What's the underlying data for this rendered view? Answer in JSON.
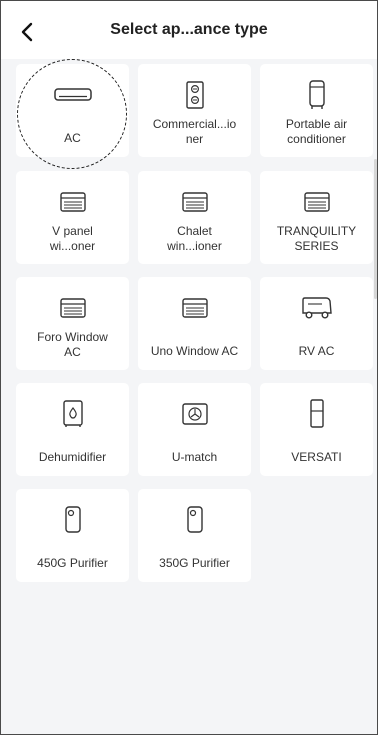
{
  "header": {
    "title": "Select ap...ance type"
  },
  "tiles": [
    {
      "label": "AC",
      "icon": "split-ac-icon"
    },
    {
      "label": "Commercial...io ner",
      "line1": "Commercial...io",
      "line2": "ner",
      "icon": "commercial-ac-icon"
    },
    {
      "label": "Portable air conditioner",
      "line1": "Portable air",
      "line2": "conditioner",
      "icon": "portable-ac-icon"
    },
    {
      "label": "V panel wi...oner",
      "line1": "V panel",
      "line2": "wi...oner",
      "icon": "window-ac-icon"
    },
    {
      "label": "Chalet win...ioner",
      "line1": "Chalet",
      "line2": "win...ioner",
      "icon": "window-ac-icon"
    },
    {
      "label": "TRANQUILITY SERIES",
      "line1": "TRANQUILITY",
      "line2": "SERIES",
      "icon": "window-ac-icon"
    },
    {
      "label": "Foro Window AC",
      "line1": "Foro Window",
      "line2": "AC",
      "icon": "window-ac-icon"
    },
    {
      "label": "Uno Window AC",
      "icon": "window-ac-icon"
    },
    {
      "label": "RV AC",
      "icon": "rv-icon"
    },
    {
      "label": "Dehumidifier",
      "icon": "dehumidifier-icon"
    },
    {
      "label": "U-match",
      "icon": "u-match-icon"
    },
    {
      "label": "VERSATI",
      "icon": "versati-icon"
    },
    {
      "label": "450G Purifier",
      "icon": "purifier-icon"
    },
    {
      "label": "350G Purifier",
      "icon": "purifier-icon"
    }
  ]
}
